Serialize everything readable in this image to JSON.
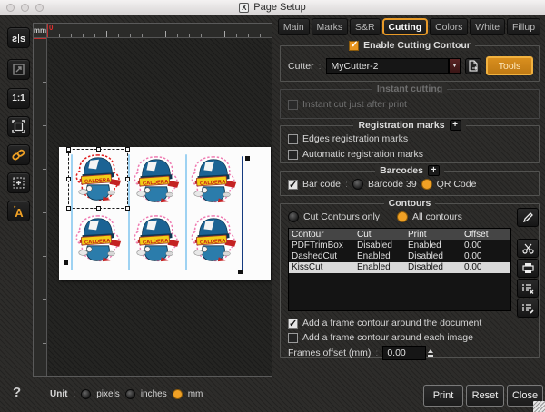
{
  "window": {
    "title": "Page Setup",
    "icon_glyph": "X"
  },
  "tabs": {
    "items": [
      "Main",
      "Marks",
      "S&R",
      "Cutting",
      "Colors",
      "White",
      "Fillup"
    ],
    "active": "Cutting"
  },
  "left_toolbar": {
    "mirror_label": "s|s",
    "actual_size_label": "1:1",
    "text_tool_label": "A",
    "text_tool_star": "*"
  },
  "canvas": {
    "ruler_unit": "mm",
    "origin_label": "0",
    "sticker_text": "CALDERA"
  },
  "cutting": {
    "enable_label": "Enable Cutting Contour",
    "cutter": {
      "label": "Cutter",
      "separator": ":",
      "value": "MyCutter-2",
      "tools_label": "Tools"
    },
    "instant": {
      "group_label": "Instant cutting",
      "checkbox_label": "Instant cut just after print"
    },
    "registration": {
      "header": "Registration marks",
      "expand_glyph": "+",
      "edges_label": "Edges registration marks",
      "automatic_label": "Automatic registration marks"
    },
    "barcodes": {
      "header": "Barcodes",
      "expand_glyph": "+",
      "checkbox_label": "Bar code",
      "separator": ":",
      "option_barcode39": "Barcode 39",
      "option_qrcode": "QR Code",
      "selected": "QR Code"
    },
    "contours": {
      "header": "Contours",
      "radio_cut_only": "Cut Contours only",
      "radio_all": "All contours",
      "selected_radio": "All contours",
      "table": {
        "headers": [
          "Contour",
          "Cut",
          "Print",
          "Offset"
        ],
        "rows": [
          [
            "PDFTrimBox",
            "Disabled",
            "Enabled",
            "0.00"
          ],
          [
            "DashedCut",
            "Enabled",
            "Disabled",
            "0.00"
          ],
          [
            "KissCut",
            "Enabled",
            "Disabled",
            "0.00"
          ]
        ],
        "selected_row": "KissCut"
      },
      "frame_document_label": "Add a frame contour around the document",
      "frame_image_label": "Add a frame contour around each image",
      "frames_offset_label": "Frames offset (mm)",
      "frames_offset_separator": ":",
      "frames_offset_value": "0.00"
    }
  },
  "footer": {
    "help_glyph": "?",
    "unit_label": "Unit",
    "separator": ":",
    "unit_options": [
      "pixels",
      "inches",
      "mm"
    ],
    "unit_selected": "mm",
    "print_label": "Print",
    "reset_label": "Reset",
    "close_label": "Close"
  },
  "colors": {
    "accent_orange": "#e89a28",
    "contour_pink": "#ef7fb4",
    "contour_red": "#e02020",
    "cutline_blue": "#9ed2f2"
  }
}
